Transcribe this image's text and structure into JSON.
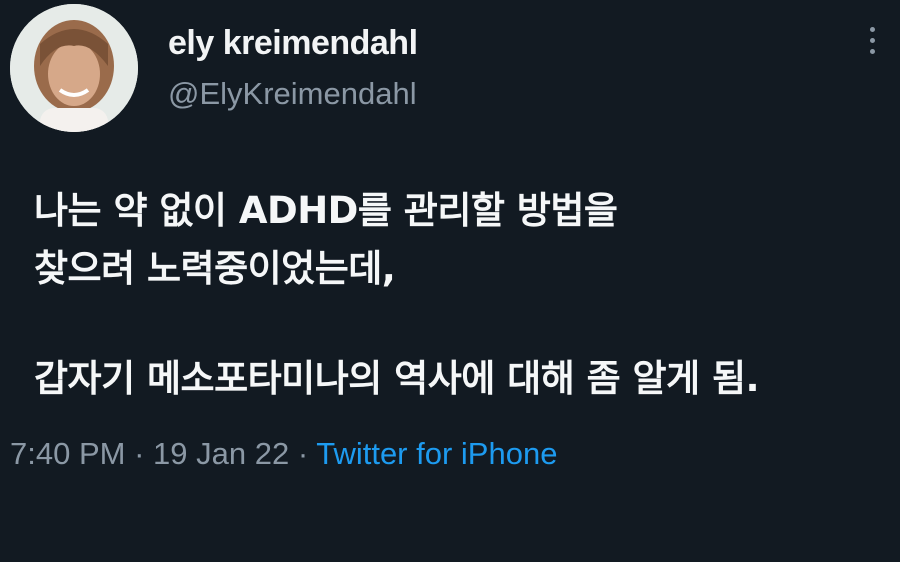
{
  "tweet": {
    "author": {
      "display_name": "ely kreimendahl",
      "handle": "@ElyKreimendahl",
      "avatar_icon": "profile-photo"
    },
    "more_icon": "more-vertical-icon",
    "text_lines": [
      "나는 약 없이 ADHD를 관리할 방법을",
      "찾으려 노력중이었는데,",
      "갑자기 메소포타미나의 역사에 대해 좀 알게 됨."
    ],
    "time": "7:40 PM",
    "date": "19 Jan 22",
    "separator": "·",
    "source": "Twitter for iPhone",
    "colors": {
      "background": "#121a22",
      "primary_text": "#f5f7f8",
      "secondary_text": "#8b98a5",
      "link": "#1d9bf0"
    }
  }
}
